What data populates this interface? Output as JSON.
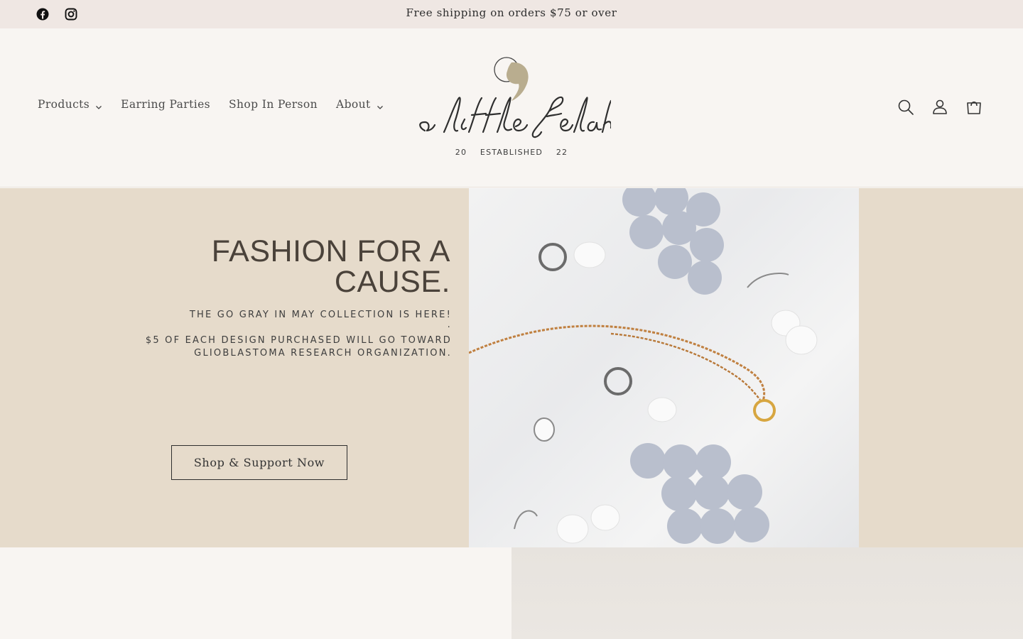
{
  "announcement": {
    "message": "Free shipping on orders $75 or over",
    "social": [
      "facebook-icon",
      "instagram-icon"
    ]
  },
  "header": {
    "nav": [
      {
        "label": "Products",
        "has_dropdown": true
      },
      {
        "label": "Earring Parties",
        "has_dropdown": false
      },
      {
        "label": "Shop In Person",
        "has_dropdown": false
      },
      {
        "label": "About",
        "has_dropdown": true
      }
    ],
    "logo": {
      "script_text": "a little Selah",
      "established": "20    ESTABLISHED    22"
    },
    "icons": [
      "search-icon",
      "account-icon",
      "cart-icon"
    ]
  },
  "hero": {
    "title": "FASHION FOR A CAUSE.",
    "subtitle_1": "THE GO GRAY IN MAY COLLECTION IS HERE!",
    "subtitle_dot": ".",
    "subtitle_2": "$5 OF EACH DESIGN PURCHASED WILL GO TOWARD GLIOBLASTOMA RESEARCH ORGANIZATION.",
    "cta_label": "Shop & Support Now"
  },
  "colors": {
    "announcement_bg": "#efe7e3",
    "page_bg": "#f8f5f2",
    "hero_bg": "#e6dbcb",
    "logo_accent": "#b9ad8f",
    "clay_gray": "#b9bfcd"
  }
}
